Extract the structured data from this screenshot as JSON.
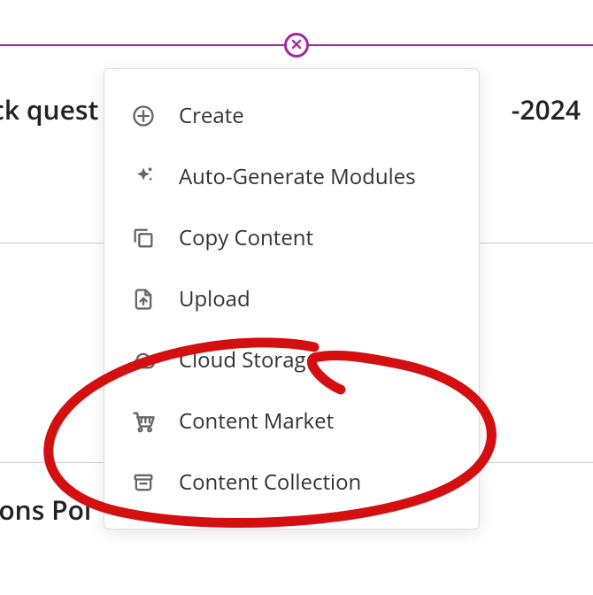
{
  "colors": {
    "accent": "#a128a1",
    "annotation": "#d40f0f"
  },
  "background": {
    "left_text": "ck quest",
    "right_text": "-2024",
    "bottom_text": "ions Poi"
  },
  "divider": {
    "close_aria": "Close"
  },
  "menu": {
    "items": [
      {
        "id": "create",
        "label": "Create",
        "icon": "plus-circle-icon"
      },
      {
        "id": "auto-generate",
        "label": "Auto-Generate Modules",
        "icon": "sparkle-icon"
      },
      {
        "id": "copy-content",
        "label": "Copy Content",
        "icon": "copy-icon"
      },
      {
        "id": "upload",
        "label": "Upload",
        "icon": "upload-file-icon"
      },
      {
        "id": "cloud-storage",
        "label": "Cloud Storage",
        "icon": "cloud-plus-icon"
      },
      {
        "id": "content-market",
        "label": "Content Market",
        "icon": "shopping-cart-icon"
      },
      {
        "id": "content-collection",
        "label": "Content Collection",
        "icon": "archive-icon"
      }
    ]
  }
}
